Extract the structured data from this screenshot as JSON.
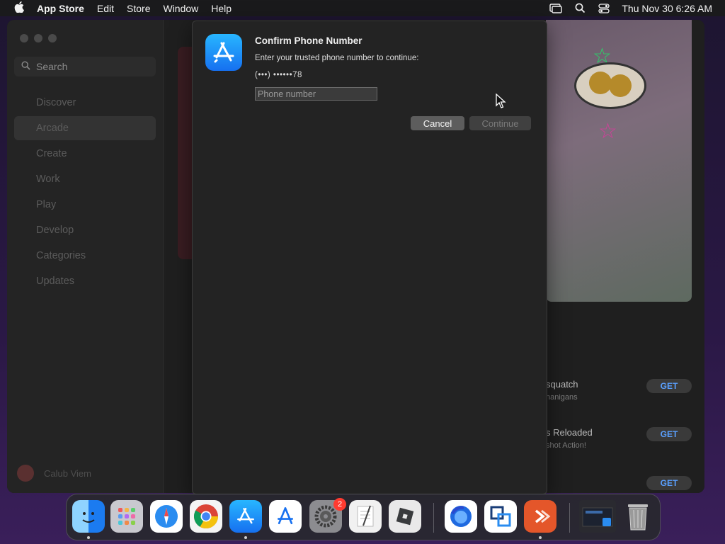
{
  "menubar": {
    "app_name": "App Store",
    "menus": [
      "Edit",
      "Store",
      "Window",
      "Help"
    ],
    "clock": "Thu Nov 30  6:26 AM"
  },
  "sidebar": {
    "search_placeholder": "Search",
    "items": [
      {
        "label": "Discover"
      },
      {
        "label": "Arcade"
      },
      {
        "label": "Create"
      },
      {
        "label": "Work"
      },
      {
        "label": "Play"
      },
      {
        "label": "Develop"
      },
      {
        "label": "Categories"
      },
      {
        "label": "Updates"
      }
    ],
    "user_name": "Calub Viem"
  },
  "main": {
    "games": [
      {
        "title": "squatch",
        "subtitle": "nanigans",
        "button": "GET"
      },
      {
        "title": "s Reloaded",
        "subtitle": "shot Action!",
        "button": "GET"
      },
      {
        "title": "",
        "subtitle": "",
        "button": "GET"
      }
    ]
  },
  "dialog": {
    "title": "Confirm Phone Number",
    "message": "Enter your trusted phone number to continue:",
    "masked_number": "(•••) ••••••78",
    "input_placeholder": "Phone number",
    "input_value": "",
    "cancel_label": "Cancel",
    "continue_label": "Continue"
  },
  "dock": {
    "settings_badge": "2"
  },
  "colors": {
    "accent": "#1670f0",
    "get_text": "#5aa0ff",
    "badge": "#ff3b30"
  }
}
